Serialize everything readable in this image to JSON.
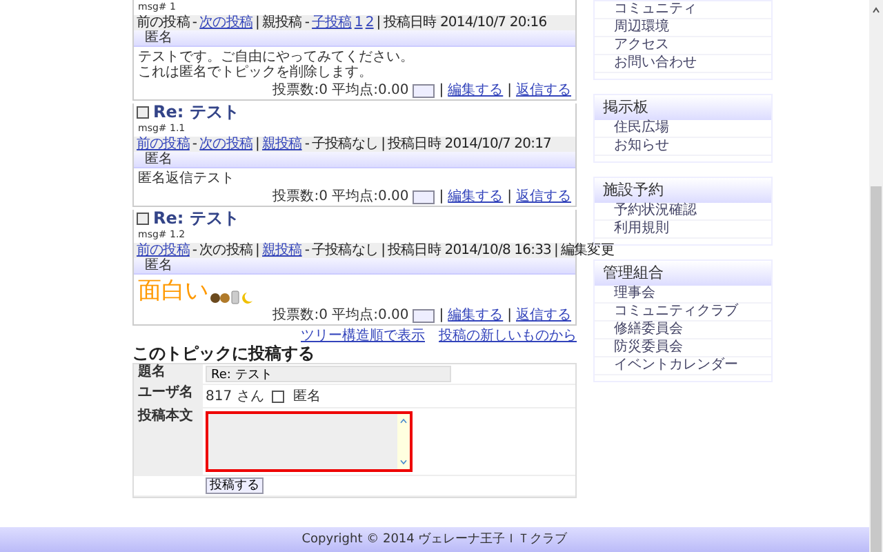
{
  "posts": [
    {
      "msg": "msg# 1",
      "nav": [
        {
          "text": "前の投稿",
          "link": false
        },
        {
          "text": "-",
          "link": false
        },
        {
          "text": "次の投稿",
          "link": true
        },
        {
          "text": "|",
          "link": false
        },
        {
          "text": "親投稿",
          "link": false
        },
        {
          "text": "-",
          "link": false
        },
        {
          "text": "子投稿",
          "link": true
        },
        {
          "text": "1",
          "link": true
        },
        {
          "text": "2",
          "link": true
        },
        {
          "text": "|",
          "link": false
        },
        {
          "text": "投稿日時 2014/10/7 20:16",
          "link": false
        }
      ],
      "author": "匿名",
      "kind": "text",
      "body": [
        "テストです。ご自由にやってみてください。",
        "これは匿名でトピックを削除します。"
      ],
      "votes": "投票数:0 平均点:0.00",
      "actions": [
        {
          "text": "|",
          "link": false
        },
        {
          "text": "編集する",
          "link": true
        },
        {
          "text": "|",
          "link": false
        },
        {
          "text": "返信する",
          "link": true
        }
      ]
    },
    {
      "title": "Re: テスト",
      "msg": "msg# 1.1",
      "nav": [
        {
          "text": "前の投稿",
          "link": true
        },
        {
          "text": "-",
          "link": false
        },
        {
          "text": "次の投稿",
          "link": true
        },
        {
          "text": "|",
          "link": false
        },
        {
          "text": "親投稿",
          "link": true
        },
        {
          "text": "-",
          "link": false
        },
        {
          "text": "子投稿なし",
          "link": false
        },
        {
          "text": "|",
          "link": false
        },
        {
          "text": "投稿日時 2014/10/7 20:17",
          "link": false
        }
      ],
      "author": "匿名",
      "kind": "text",
      "body": [
        "匿名返信テスト"
      ],
      "votes": "投票数:0 平均点:0.00",
      "actions": [
        {
          "text": "|",
          "link": false
        },
        {
          "text": "編集する",
          "link": true
        },
        {
          "text": "|",
          "link": false
        },
        {
          "text": "返信する",
          "link": true
        }
      ]
    },
    {
      "title": "Re: テスト",
      "msg": "msg# 1.2",
      "nav": [
        {
          "text": "前の投稿",
          "link": true
        },
        {
          "text": "-",
          "link": false
        },
        {
          "text": "次の投稿",
          "link": false
        },
        {
          "text": "|",
          "link": false
        },
        {
          "text": "親投稿",
          "link": true
        },
        {
          "text": "-",
          "link": false
        },
        {
          "text": "子投稿なし",
          "link": false
        },
        {
          "text": "|",
          "link": false
        },
        {
          "text": "投稿日時 2014/10/8 16:33",
          "link": false
        },
        {
          "text": "|",
          "link": false
        },
        {
          "text": "編集変更",
          "link": false
        }
      ],
      "author": "匿名",
      "kind": "big",
      "body": [
        "面白い"
      ],
      "votes": "投票数:0 平均点:0.00",
      "actions": [
        {
          "text": "|",
          "link": false
        },
        {
          "text": "編集する",
          "link": true
        },
        {
          "text": "|",
          "link": false
        },
        {
          "text": "返信する",
          "link": true
        }
      ]
    }
  ],
  "form": {
    "links": [
      "ツリー構造順で表示",
      "投稿の新しいものから"
    ],
    "heading": "このトピックに投稿する",
    "rows": [
      {
        "kind": "input",
        "label": "題名",
        "value": "Re: テスト"
      },
      {
        "kind": "user",
        "label": "ユーザ名",
        "value": "817 さん",
        "checkbox": {
          "label": "匿名",
          "checked": false
        }
      },
      {
        "kind": "textarea",
        "label": "投稿本文",
        "highlighted": true
      }
    ],
    "submit": "投稿する"
  },
  "sidebar": {
    "top_items": [
      "コミュニティ",
      "周辺環境",
      "アクセス",
      "お問い合わせ"
    ],
    "boxes": [
      {
        "title": "掲示板",
        "items": [
          "住民広場",
          "お知らせ"
        ]
      },
      {
        "title": "施設予約",
        "items": [
          "予約状況確認",
          "利用規則"
        ]
      },
      {
        "title": "管理組合",
        "items": [
          "理事会",
          "コミュニティクラブ",
          "修繕委員会",
          "防災委員会",
          "イベントカレンダー"
        ]
      }
    ]
  },
  "footer": "Copyright © 2014 ヴェレーナ王子ＩＴクラブ"
}
